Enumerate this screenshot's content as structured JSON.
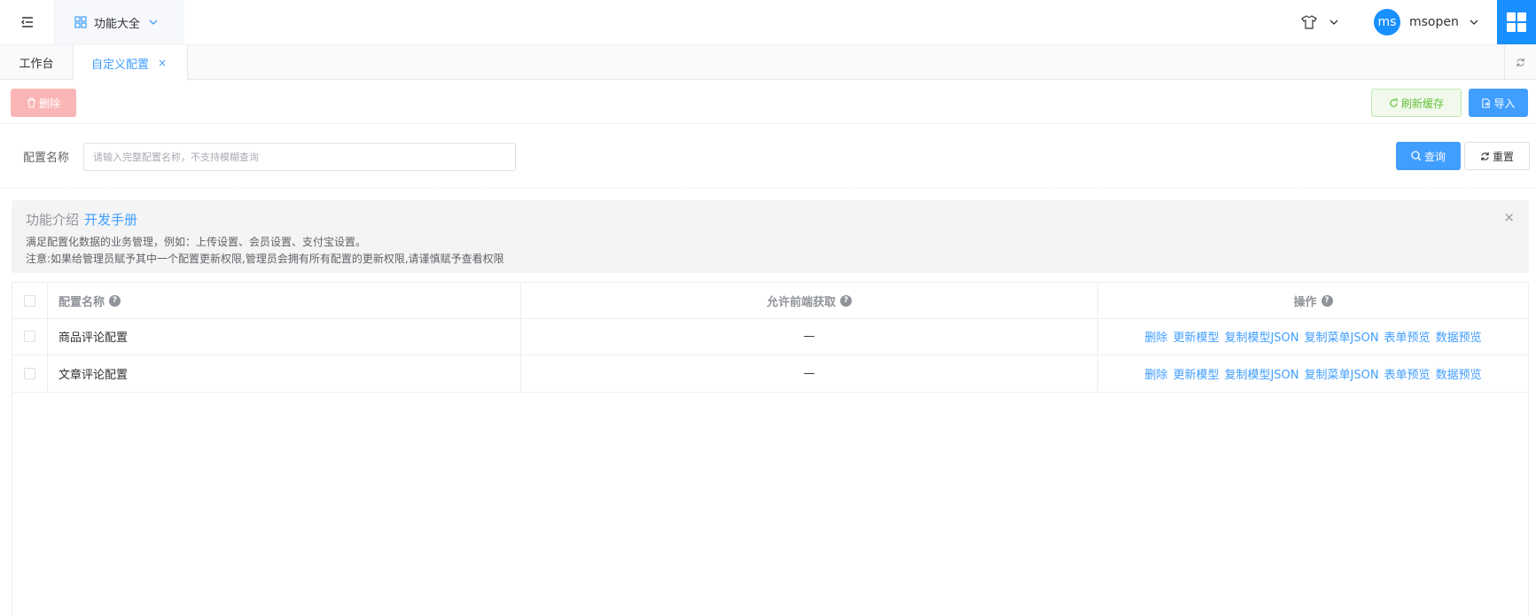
{
  "header": {
    "apps_label": "功能大全",
    "user": {
      "avatar_text": "ms",
      "name": "msopen"
    }
  },
  "tabs": [
    {
      "label": "工作台",
      "active": false
    },
    {
      "label": "自定义配置",
      "active": true,
      "close": "×"
    }
  ],
  "toolbar": {
    "delete_label": "删除",
    "refresh_cache_label": "刷新缓存",
    "import_label": "导入"
  },
  "search": {
    "label": "配置名称",
    "placeholder": "请输入完整配置名称，不支持模糊查询",
    "value": "",
    "query_label": "查询",
    "reset_label": "重置"
  },
  "alert": {
    "title": "功能介绍",
    "link": "开发手册",
    "line1": "满足配置化数据的业务管理，例如：上传设置、会员设置、支付宝设置。",
    "line2": "注意:如果给管理员赋予其中一个配置更新权限,管理员会拥有所有配置的更新权限,请谨慎赋予查看权限",
    "close": "×"
  },
  "table": {
    "columns": [
      "配置名称",
      "允许前端获取",
      "操作"
    ],
    "rows": [
      {
        "name": "商品评论配置",
        "allow": "—"
      },
      {
        "name": "文章评论配置",
        "allow": "—"
      }
    ],
    "actions": [
      "删除",
      "更新模型",
      "复制模型JSON",
      "复制菜单JSON",
      "表单预览",
      "数据预览"
    ]
  },
  "colors": {
    "primary": "#409eff",
    "danger_light": "#fab6b6",
    "success": "#67c23a",
    "brand": "#1890ff"
  }
}
